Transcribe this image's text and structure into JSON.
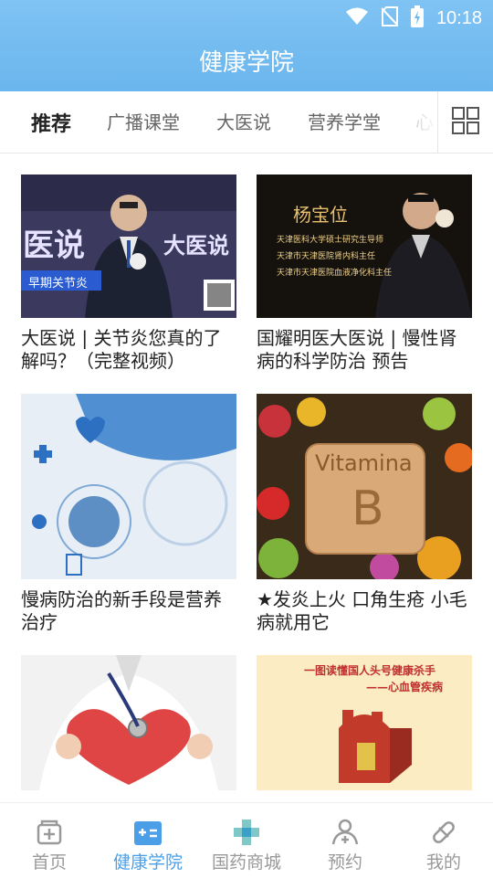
{
  "status": {
    "time": "10:18"
  },
  "header": {
    "title": "健康学院"
  },
  "tabs": [
    {
      "label": "推荐"
    },
    {
      "label": "广播课堂"
    },
    {
      "label": "大医说"
    },
    {
      "label": "营养学堂"
    },
    {
      "label": "心"
    }
  ],
  "cards": [
    {
      "title": "大医说 | 关节炎您真的了解吗？（完整视频）",
      "image_text": [
        "医说",
        "大医说",
        "早期关节炎"
      ]
    },
    {
      "title": "国耀明医大医说 | 慢性肾病的科学防治 预告",
      "image_text": [
        "杨宝位",
        "天津医科大学硕士研究生导师",
        "天津市天津医院肾内科主任",
        "天津市天津医院血液净化科主任"
      ]
    },
    {
      "title": "慢病防治的新手段是营养治疗",
      "image_text": []
    },
    {
      "title": "★发炎上火 口角生疮 小毛病就用它",
      "image_text": [
        "Vitamina",
        "B"
      ]
    },
    {
      "title": "",
      "image_text": []
    },
    {
      "title": "",
      "image_text": [
        "一图读懂国人头号健康杀手",
        "——心血管疾病"
      ]
    }
  ],
  "bottom_nav": [
    {
      "label": "首页",
      "icon": "home-icon"
    },
    {
      "label": "健康学院",
      "icon": "academy-icon"
    },
    {
      "label": "国药商城",
      "icon": "pharmacy-cross-icon"
    },
    {
      "label": "预约",
      "icon": "appointment-icon"
    },
    {
      "label": "我的",
      "icon": "profile-icon"
    }
  ],
  "colors": {
    "header": "#6ab6ee",
    "active_nav": "#4a9fe6",
    "inactive_nav": "#999999"
  }
}
